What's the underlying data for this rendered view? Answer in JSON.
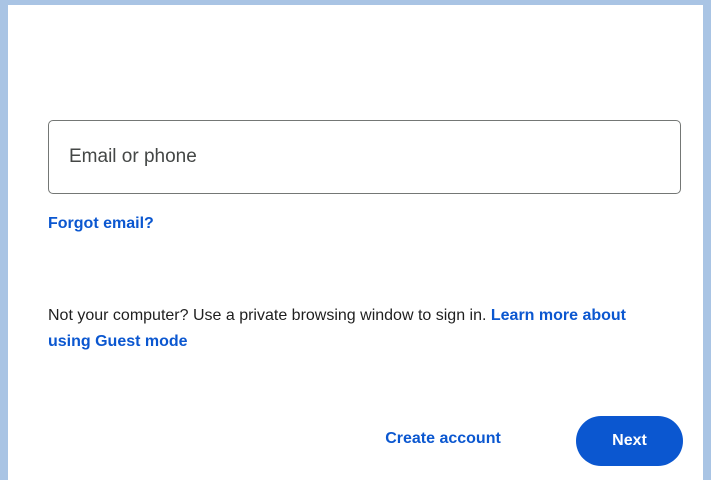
{
  "colors": {
    "page_frame": "#a9c4e4",
    "card_background": "#ffffff",
    "accent": "#0b57d0",
    "border": "#747775",
    "text": "#1f1f1f"
  },
  "signin": {
    "email_placeholder": "Email or phone",
    "email_value": "",
    "forgot_email_label": "Forgot email?",
    "guest_message": "Not your computer? Use a private browsing window to sign in.",
    "guest_link_label": "Learn more about using Guest mode",
    "create_account_label": "Create account",
    "next_label": "Next"
  }
}
